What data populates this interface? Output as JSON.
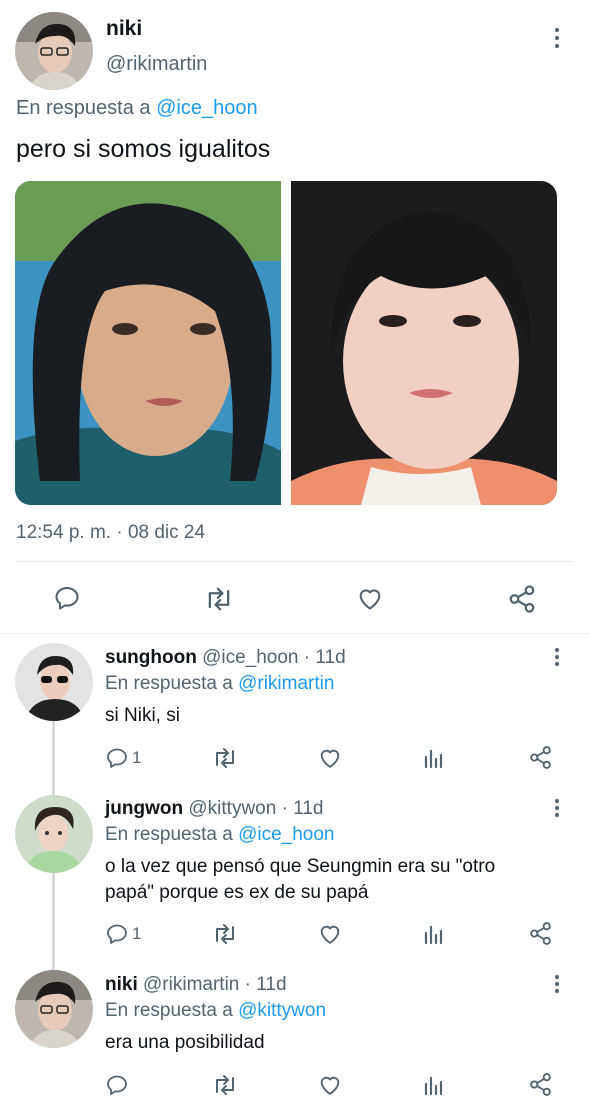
{
  "main_tweet": {
    "display_name": "niki",
    "handle": "@rikimartin",
    "reply_prefix": "En respuesta a",
    "reply_to": "@ice_hoon",
    "text": "pero si somos igualitos",
    "timestamp": "12:54 p. m. · 08 dic 24"
  },
  "replies": [
    {
      "display_name": "sunghoon",
      "handle": "@ice_hoon",
      "age": "· 11d",
      "reply_prefix": "En respuesta a",
      "reply_to": "@rikimartin",
      "text": "si Niki, si",
      "reply_count": "1"
    },
    {
      "display_name": "jungwon",
      "handle": "@kittywon",
      "age": "· 11d",
      "reply_prefix": "En respuesta a",
      "reply_to": "@ice_hoon",
      "text_line1": "o la vez que pensó que Seungmin era su \"otro",
      "text_line2": "papá\" porque es ex de su papá",
      "reply_count": "1"
    },
    {
      "display_name": "niki",
      "handle": "@rikimartin",
      "age": "· 11d",
      "reply_prefix": "En respuesta a",
      "reply_to": "@kittywon",
      "text": "era una posibilidad",
      "reply_count": ""
    }
  ],
  "colors": {
    "link": "#1d9bf0",
    "muted": "#536471",
    "text": "#0f1419",
    "divider": "#e6e9eb"
  },
  "icons": {
    "reply": "reply-icon",
    "retweet": "retweet-icon",
    "like": "heart-icon",
    "views": "views-icon",
    "share": "share-icon",
    "more": "more-icon"
  }
}
